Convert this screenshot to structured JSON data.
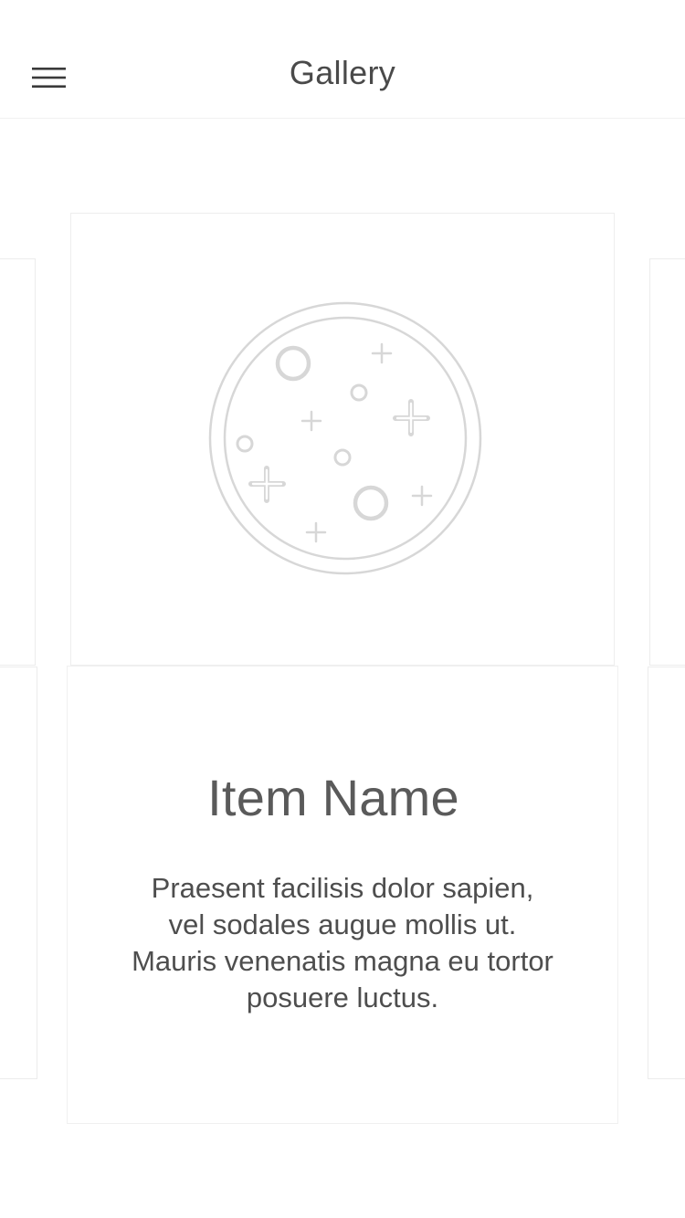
{
  "header": {
    "title": "Gallery"
  },
  "gallery": {
    "current_item": {
      "name": "Item Name",
      "description": "Praesent facilisis dolor sapien, vel sodales augue mollis ut. Mauris venenatis magna eu tortor posuere luctus.",
      "image_icon": "placeholder-moon-icon"
    }
  },
  "icons": {
    "menu": "hamburger-menu-icon"
  },
  "colors": {
    "text": "#5a5a5a",
    "border": "#ececec",
    "icon_stroke": "#d4d4d4"
  }
}
